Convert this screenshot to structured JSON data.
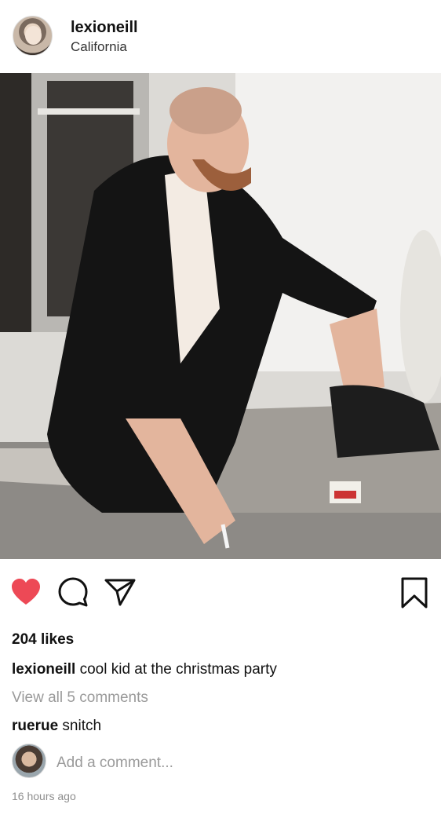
{
  "post": {
    "username": "lexioneill",
    "location": "California",
    "likes": "204 likes",
    "caption_user": "lexioneill",
    "caption_text": "cool kid at the christmas party",
    "view_all": "View all 5 comments",
    "liked": true,
    "timestamp": "16 hours ago"
  },
  "comments": [
    {
      "user": "ruerue",
      "text": "snitch"
    }
  ],
  "add_comment": {
    "placeholder": "Add a comment..."
  },
  "icons": {
    "heart": "heart-icon",
    "comment": "comment-icon",
    "share": "paper-plane-icon",
    "bookmark": "bookmark-icon"
  },
  "colors": {
    "like": "#ed4956",
    "secondary_text": "#9a9a9a"
  }
}
